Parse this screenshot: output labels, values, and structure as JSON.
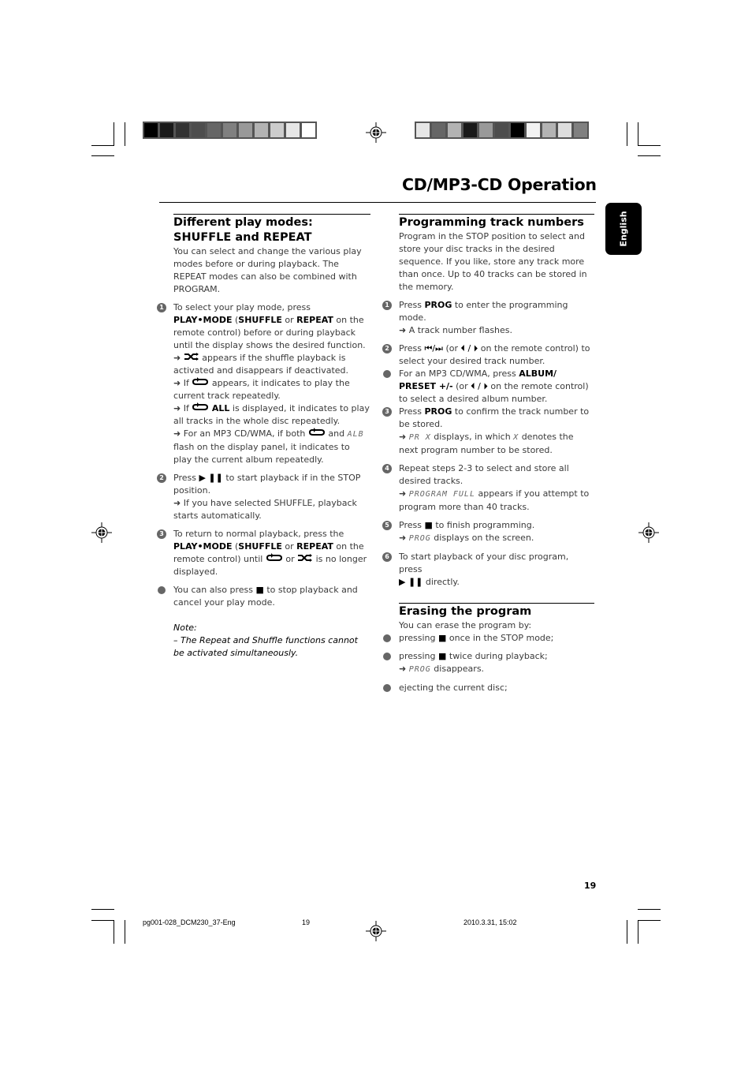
{
  "page": {
    "title": "CD/MP3-CD Operation",
    "language_tab": "English",
    "page_number": "19"
  },
  "color_bars": {
    "left": [
      "#000000",
      "#1a1a1a",
      "#333333",
      "#4d4d4d",
      "#666666",
      "#808080",
      "#999999",
      "#b3b3b3",
      "#cccccc",
      "#e6e6e6",
      "#ffffff"
    ],
    "right": [
      "#e6e6e6",
      "#666666",
      "#b3b3b3",
      "#1a1a1a",
      "#999999",
      "#4d4d4d",
      "#000000",
      "#f2f2f2",
      "#b3b3b3",
      "#dddddd",
      "#808080"
    ]
  },
  "left_column": {
    "heading": "Different play modes: SHUFFLE and REPEAT",
    "intro": "You can select and change the various play modes before or during playback. The REPEAT modes can also be combined with PROGRAM.",
    "step1": {
      "marker": "1",
      "t1": "To select your play mode, press ",
      "b1": "PLAY•MODE",
      "t2": " (",
      "b2": "SHUFFLE",
      "t3": " or ",
      "b3": "REPEAT",
      "t4": " on the remote control) before or during playback until the display shows the desired function.",
      "r1": " appears if the shuffle playback is activated and disappears if deactivated.",
      "r2a": " If ",
      "r2b": " appears, it indicates to play the current track repeatedly.",
      "r3a": " If ",
      "r3b": "ALL",
      "r3c": " is displayed, it indicates to play all tracks in the whole disc repeatedly.",
      "r4a": " For an MP3 CD/WMA, if both ",
      "r4b": " and ",
      "r4lcd": "ALB",
      "r4c": " flash on the display panel, it indicates to play the current album repeatedly."
    },
    "step2": {
      "marker": "2",
      "t1": "Press ",
      "t2": " to start playback if in the STOP position.",
      "r1": " If you have selected SHUFFLE, playback starts automatically."
    },
    "step3": {
      "marker": "3",
      "t1": "To return to normal playback, press the ",
      "b1": "PLAY•MODE",
      "t2": " (",
      "b2": "SHUFFLE",
      "t3": " or ",
      "b3": "REPEAT",
      "t4": " on the remote control) until ",
      "t5": " or ",
      "t6": " is no longer displayed."
    },
    "bullet": {
      "t1": "You can also press ",
      "t2": " to stop playback and cancel your play mode."
    },
    "note_label": "Note:",
    "note_text": "– The Repeat and Shuffle functions cannot be activated simultaneously."
  },
  "right_column": {
    "heading1": "Programming track numbers",
    "intro": "Program in the STOP position to select and store your disc tracks in the desired sequence. If you like, store any track more than once. Up to 40 tracks can be stored in the memory.",
    "step1": {
      "marker": "1",
      "t1": "Press ",
      "b1": "PROG",
      "t2": " to enter the programming mode.",
      "r1": " A track number flashes."
    },
    "step2": {
      "marker": "2",
      "t1": "Press ",
      "t2": " (or ",
      "t3": " on the remote control) to select your desired track number."
    },
    "bullet_mp3": {
      "t1": "For an MP3 CD/WMA,  press ",
      "b1": "ALBUM/ PRESET +/-",
      "t2": " (or ",
      "t3": " on the remote control) to select a desired album number."
    },
    "step3": {
      "marker": "3",
      "t1": "Press ",
      "b1": "PROG",
      "t2": " to confirm the track number to be stored.",
      "lcd1": "PR X",
      "r1": " displays, in which ",
      "lcd2": "X",
      "r2": " denotes the next program number to be stored."
    },
    "step4": {
      "marker": "4",
      "t1": "Repeat steps 2-3 to select and store all desired tracks.",
      "lcd": "PROGRAM FULL",
      "r1": " appears if you attempt to program more than 40 tracks."
    },
    "step5": {
      "marker": "5",
      "t1": "Press ",
      "t2": " to finish programming.",
      "lcd": "PROG",
      "r1": " displays on the screen."
    },
    "step6": {
      "marker": "6",
      "t1": "To start playback of your disc program, press",
      "t2": " directly."
    },
    "heading2": "Erasing the program",
    "erase_intro": "You can erase the program by:",
    "erase1": {
      "t1": "pressing ",
      "t2": " once in the STOP mode;"
    },
    "erase2": {
      "t1": "pressing ",
      "t2": " twice during playback;",
      "lcd": "PROG",
      "r1": " disappears."
    },
    "erase3": "ejecting the current disc;"
  },
  "footer": {
    "file": "pg001-028_DCM230_37-Eng",
    "page": "19",
    "date": "2010.3.31, 15:02"
  }
}
